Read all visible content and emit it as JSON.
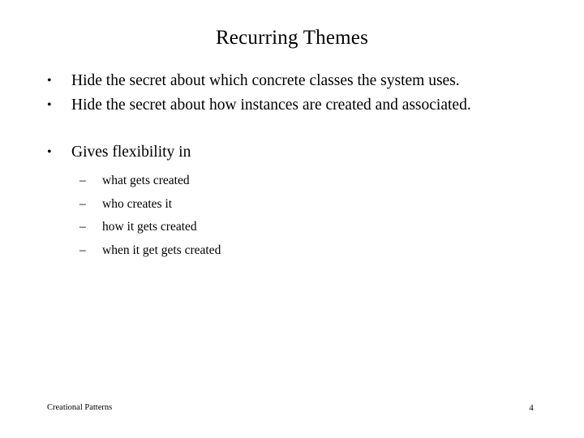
{
  "slide": {
    "title": "Recurring Themes",
    "background_color": "#ffffff",
    "text_color": "#000000",
    "bullets": [
      {
        "level": 1,
        "marker": "•",
        "text": "Hide the secret about which concrete classes the system uses."
      },
      {
        "level": 1,
        "marker": "•",
        "text": "Hide the secret about how instances are created and associated."
      },
      {
        "level": 1,
        "marker": "•",
        "text": "Gives flexibility in"
      }
    ],
    "sub_bullets": [
      {
        "level": 2,
        "marker": "–",
        "text": "what gets created"
      },
      {
        "level": 2,
        "marker": "–",
        "text": "who creates it"
      },
      {
        "level": 2,
        "marker": "–",
        "text": "how it gets created"
      },
      {
        "level": 2,
        "marker": "–",
        "text": "when it get gets created"
      }
    ],
    "footer": {
      "left_text": "Creational Patterns",
      "page_number": "4"
    }
  }
}
